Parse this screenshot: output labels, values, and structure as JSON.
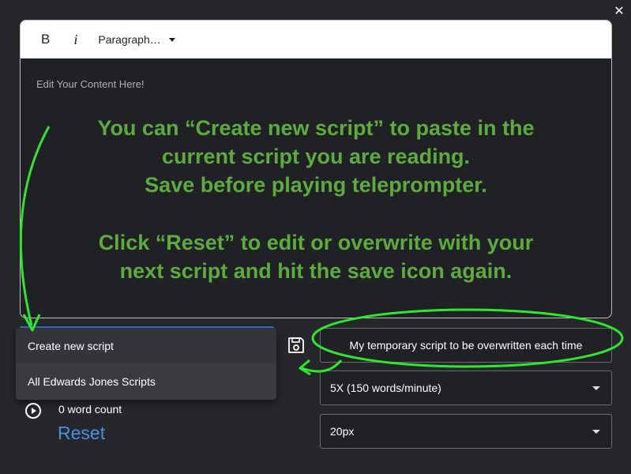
{
  "window": {
    "close_label": "✕"
  },
  "toolbar": {
    "bold_label": "B",
    "italic_label": "i",
    "format_label": "Paragraph…"
  },
  "editor": {
    "placeholder": "Edit Your Content Here!"
  },
  "annotation": {
    "line1": "You can “Create new script” to paste in the",
    "line2": "current script you are reading.",
    "line3": "Save before playing teleprompter.",
    "line4": "Click “Reset” to edit or overwrite with your",
    "line5": "next script and hit the save icon again.",
    "color": "#5dab3e",
    "arrow_color": "#2ee82e"
  },
  "script_menu": {
    "items": [
      {
        "label": "Create new script"
      },
      {
        "label": "All Edwards Jones Scripts"
      }
    ]
  },
  "script_name": {
    "value": "My temporary script to be overwritten each time"
  },
  "speed_select": {
    "value": "5X (150 words/minute)"
  },
  "font_size_select": {
    "value": "20px"
  },
  "status": {
    "word_count": "0 word count"
  },
  "reset": {
    "label": "Reset"
  },
  "icons": {
    "save": "save-icon",
    "play": "play-icon",
    "close": "close-icon"
  }
}
